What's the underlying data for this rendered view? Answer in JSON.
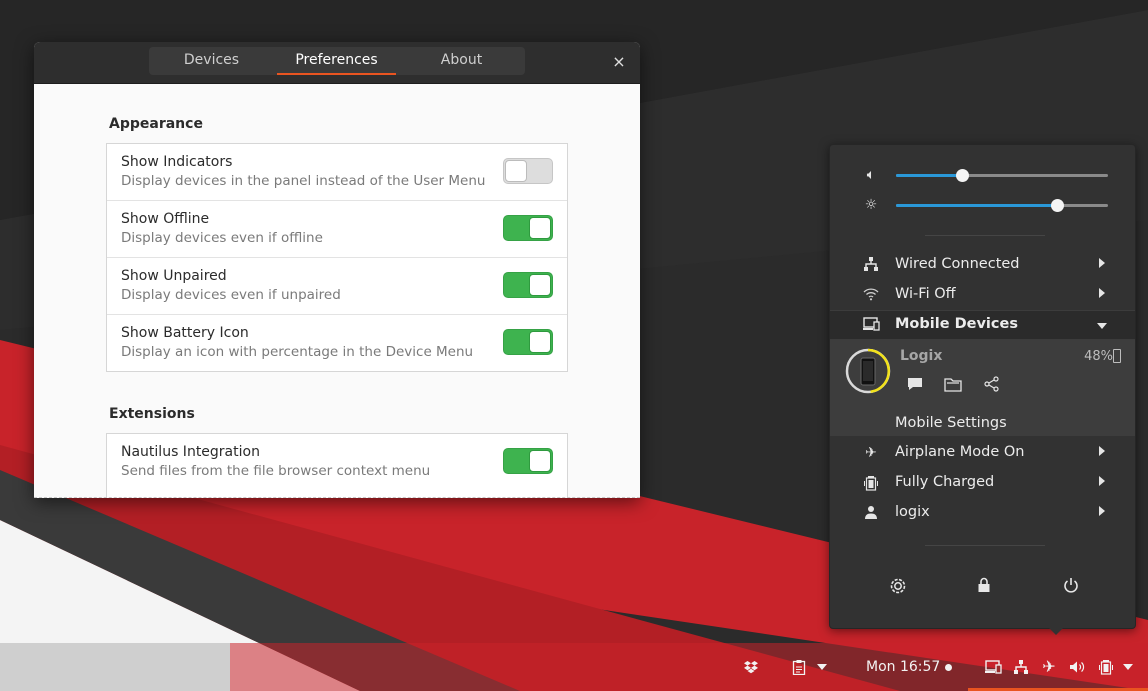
{
  "window": {
    "tabs": [
      "Devices",
      "Preferences",
      "About"
    ],
    "active_tab": "Preferences",
    "close_glyph": "×"
  },
  "appearance": {
    "title": "Appearance",
    "rows": [
      {
        "title": "Show Indicators",
        "subtitle": "Display devices in the panel instead of the User Menu",
        "on": false
      },
      {
        "title": "Show Offline",
        "subtitle": "Display devices even if offline",
        "on": true
      },
      {
        "title": "Show Unpaired",
        "subtitle": "Display devices even if unpaired",
        "on": true
      },
      {
        "title": "Show Battery Icon",
        "subtitle": "Display an icon with percentage in the Device Menu",
        "on": true
      }
    ]
  },
  "extensions": {
    "title": "Extensions",
    "rows": [
      {
        "title": "Nautilus Integration",
        "subtitle": "Send files from the file browser context menu",
        "on": true
      }
    ]
  },
  "panel": {
    "clock": "Mon 16:57",
    "icons": [
      "dropbox-icon",
      "clipboard-icon",
      "mobile-devices-icon",
      "network-icon",
      "airplane-icon",
      "volume-icon",
      "battery-icon"
    ]
  },
  "menu": {
    "volume_level": 0.31,
    "brightness_level": 0.76,
    "items": {
      "wired": "Wired Connected",
      "wifi": "Wi-Fi Off",
      "mobile": "Mobile Devices",
      "device_name": "Logix",
      "device_battery": "48%",
      "mobile_settings": "Mobile Settings",
      "airplane": "Airplane Mode On",
      "power": "Fully Charged",
      "user": "logix"
    }
  },
  "colors": {
    "accent": "#e95420",
    "switch_on": "#3eb34f",
    "slider": "#2a98d8",
    "wallpaper_red": "#c8232a"
  }
}
